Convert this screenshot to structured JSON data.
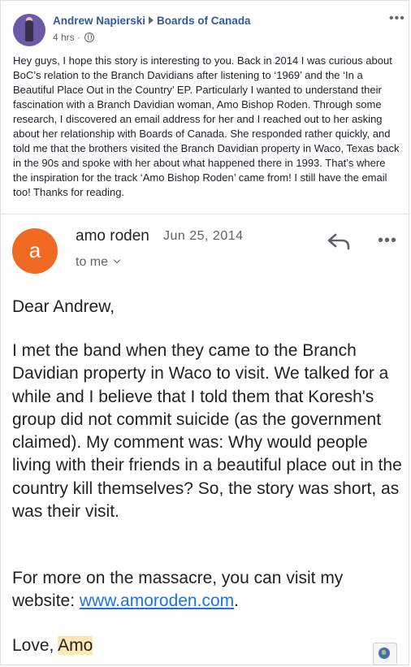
{
  "post": {
    "author": "Andrew Napierski",
    "group": "Boards of Canada",
    "time": "4 hrs",
    "more_icon": "more-horizontal-icon",
    "text": "Hey guys, I hope this story is interesting to you. Back in 2014 I was curious about BoC’s relation to the Branch Davidians after listening to ‘1969’ and the ‘In a Beautiful Place Out in the Country’ EP. Particularly I wanted to understand their fascination with a Branch Davidian woman, Amo Bishop Roden. Through some research, I discovered an email address for her and I reached out to her asking about her relationship with Boards of Canada. She responded rather quickly, and told me that the brothers visited the Branch Davidian property in Waco, Texas back in the 90s and spoke with her about what happened there in 1993. That’s where the inspiration for the track ‘Amo Bishop Roden’ came from! I still have the email too! Thanks for reading."
  },
  "email": {
    "avatar_letter": "a",
    "avatar_color": "#f16a21",
    "sender": "amo roden",
    "date": "Jun 25, 2014",
    "to": "to me",
    "greeting": "Dear Andrew,",
    "paragraph1": "I met the band when they came to the Branch Davidian property in Waco to visit. We talked for a while and I believe that I told them that Koresh's group did not commit suicide (as the government claimed). My comment was: Why would people living with their friends in a beautiful place out in the country kill themselves? So, the story was short, as was their visit.",
    "paragraph2_prefix": "For more on the massacre, you can visit my website: ",
    "link": "www.amoroden.com",
    "paragraph2_suffix": ".",
    "signoff_prefix": "Love, ",
    "signoff_name": "Amo"
  },
  "colors": {
    "author_link": "#365899",
    "link": "#1a73e8",
    "highlight": "#fce8b2"
  }
}
